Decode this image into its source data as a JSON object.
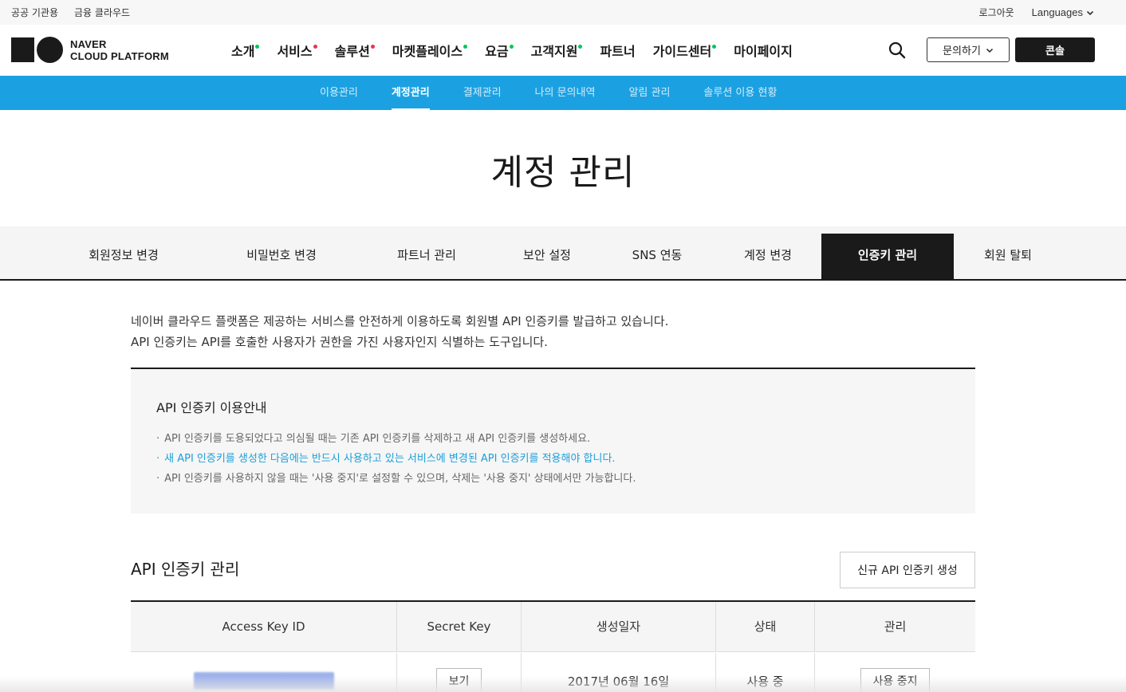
{
  "util": {
    "left_links": [
      "공공 기관용",
      "금융 클라우드"
    ],
    "logout": "로그아웃",
    "languages": "Languages"
  },
  "header": {
    "logo_line1": "NAVER",
    "logo_line2": "CLOUD PLATFORM",
    "menu": [
      {
        "label": "소개",
        "dot_color": "#03c75a"
      },
      {
        "label": "서비스",
        "dot_color": "#e8374a"
      },
      {
        "label": "솔루션",
        "dot_color": "#e8374a"
      },
      {
        "label": "마켓플레이스",
        "dot_color": "#03c75a"
      },
      {
        "label": "요금",
        "dot_color": "#03c75a"
      },
      {
        "label": "고객지원",
        "dot_color": "#03c75a"
      },
      {
        "label": "파트너",
        "dot_color": ""
      },
      {
        "label": "가이드센터",
        "dot_color": "#03c75a"
      },
      {
        "label": "마이페이지",
        "dot_color": ""
      }
    ],
    "inquiry_label": "문의하기",
    "console_label": "콘솔"
  },
  "subnav": {
    "items": [
      "이용관리",
      "계정관리",
      "결제관리",
      "나의 문의내역",
      "알림 관리",
      "솔루션 이용 현황"
    ],
    "active_index": 1
  },
  "page_title": "계정 관리",
  "tabs": {
    "items": [
      "회원정보 변경",
      "비밀번호 변경",
      "파트너 관리",
      "보안 설정",
      "SNS 연동",
      "계정 변경",
      "인증키 관리",
      "회원 탈퇴"
    ],
    "active_index": 6
  },
  "intro": {
    "line1": "네이버 클라우드 플랫폼은 제공하는 서비스를 안전하게 이용하도록 회원별 API 인증키를 발급하고 있습니다.",
    "line2": "API 인증키는 API를 호출한 사용자가 권한을 가진 사용자인지 식별하는 도구입니다."
  },
  "notice": {
    "title": "API 인증키 이용안내",
    "items": [
      "API 인증키를 도용되었다고 의심될 때는 기존 API 인증키를 삭제하고 새 API 인증키를 생성하세요.",
      "새 API 인증키를 생성한 다음에는 반드시 사용하고 있는 서비스에 변경된 API 인증키를 적용해야 합니다.",
      "API 인증키를 사용하지 않을 때는 '사용 중지'로 설정할 수 있으며, 삭제는 '사용 중지' 상태에서만 가능합니다."
    ],
    "highlight_color": "#1b9fd8"
  },
  "keys": {
    "section_title": "API 인증키 관리",
    "new_button": "신규 API 인증키 생성",
    "columns": [
      "Access Key ID",
      "Secret Key",
      "생성일자",
      "상태",
      "관리"
    ],
    "rows": [
      {
        "secret_button": "보기",
        "created": "2017년 06월 16일",
        "status": "사용 중",
        "action": "사용 중지"
      }
    ]
  }
}
